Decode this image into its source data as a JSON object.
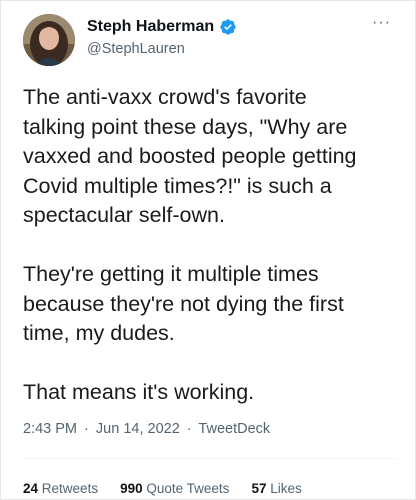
{
  "author": {
    "display_name": "Steph Haberman",
    "handle": "@StephLauren",
    "verified": true
  },
  "menu": {
    "more_label": "···"
  },
  "tweet": {
    "paragraphs": [
      "The anti-vaxx crowd's favorite\ntalking point these days, \"Why are\nvaxxed and boosted people getting\nCovid multiple times?!\" is such a\nspectacular self-own.",
      "They're getting it multiple times\nbecause they're not dying the first\ntime, my dudes.",
      "That means it's working."
    ]
  },
  "meta": {
    "time": "2:43 PM",
    "date": "Jun 14, 2022",
    "source": "TweetDeck",
    "separator": "·"
  },
  "stats": {
    "retweets_count": "24",
    "retweets_label": "Retweets",
    "quotes_count": "990",
    "quotes_label": "Quote Tweets",
    "likes_count": "57",
    "likes_label": "Likes"
  },
  "colors": {
    "verified_blue": "#1d9bf0",
    "secondary_text": "#536471",
    "primary_text": "#0f1419"
  }
}
